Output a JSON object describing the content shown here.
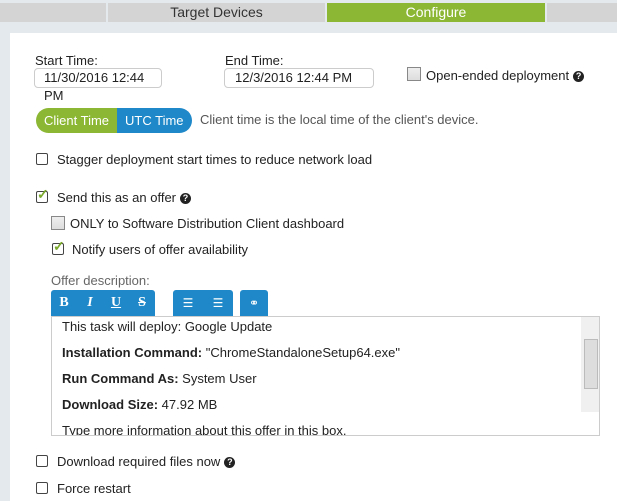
{
  "tabs": [
    {
      "label": ""
    },
    {
      "label": "Target Devices"
    },
    {
      "label": "Configure",
      "active": true
    },
    {
      "label": ""
    }
  ],
  "start": {
    "label": "Start Time:",
    "value": "11/30/2016 12:44 PM"
  },
  "end": {
    "label": "End Time:",
    "value": "12/3/2016 12:44 PM"
  },
  "open_ended": {
    "label": "Open-ended deployment",
    "checked": false
  },
  "time_toggle": {
    "client": "Client Time",
    "utc": "UTC Time",
    "selected": "Client Time",
    "note": "Client time is the local time of the client's device."
  },
  "stagger": {
    "label": "Stagger deployment start times to reduce network load",
    "checked": false
  },
  "offer": {
    "label": "Send this as an offer",
    "checked": true
  },
  "only_sdc": {
    "label": "ONLY to Software Distribution Client dashboard",
    "checked": false
  },
  "notify": {
    "label": "Notify users of offer availability",
    "checked": true
  },
  "offer_desc_label": "Offer description:",
  "toolbar": {
    "bold": "B",
    "italic": "I",
    "underline": "U",
    "strike": "S"
  },
  "editor": {
    "line1": "This task will deploy: Google Update",
    "install_label": "Installation Command:",
    "install_value": " \"ChromeStandaloneSetup64.exe\"",
    "runas_label": "Run Command As:",
    "runas_value": " System User",
    "size_label": "Download Size:",
    "size_value": " 47.92 MB",
    "more": "Type more information about this offer in this box."
  },
  "download": {
    "label": "Download required files now",
    "checked": false
  },
  "restart": {
    "label": "Force restart",
    "checked": false
  },
  "colors": {
    "green": "#8cb734",
    "blue": "#1e88c8"
  }
}
